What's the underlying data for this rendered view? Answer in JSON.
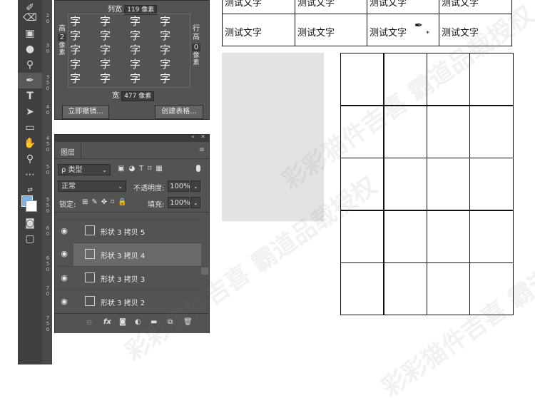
{
  "toolbar": {
    "tools": [
      "brush-icon",
      "eraser-icon",
      "gradient-icon",
      "blur-icon",
      "dodge-icon",
      "pen-icon",
      "type-icon",
      "path-select-icon",
      "rectangle-icon",
      "hand-icon",
      "zoom-icon",
      "more-icon",
      "swap-colors-icon",
      "foreground-color-icon",
      "quick-mask-icon",
      "screen-mode-icon"
    ],
    "foreground_color": "#7ab3e6"
  },
  "ruler": {
    "labels": [
      "2",
      "0",
      "3",
      "0",
      "3",
      "5",
      "0",
      "4",
      "0",
      "4",
      "5",
      "0",
      "5",
      "0",
      "5",
      "5",
      "0",
      "6",
      "0",
      "6",
      "5",
      "0",
      "7",
      "0",
      "7",
      "5",
      "0"
    ]
  },
  "table_panel": {
    "col_width_label": "列宽",
    "col_width_value": "119 像素",
    "row_height_label": "高",
    "row_height_value": "2",
    "row_height_unit": "像素",
    "rows_label": "行",
    "rows_label2": "高",
    "rows_value": "0",
    "rows_unit": "像素",
    "width_label": "宽",
    "width_value": "477 像素",
    "grid_char": "字",
    "undo_button": "立即撤销...",
    "create_button": "创建表格..."
  },
  "layers_panel": {
    "tab_label": "图层",
    "filter_label": "ρ 类型",
    "blend_mode": "正常",
    "opacity_label": "不透明度:",
    "opacity_value": "100%",
    "lock_label": "锁定:",
    "fill_label": "填充:",
    "fill_value": "100%",
    "layers": [
      {
        "name": "形状 3 拷贝 5"
      },
      {
        "name": "形状 3 拷贝 4"
      },
      {
        "name": "形状 3 拷贝 3"
      },
      {
        "name": "形状 3 拷贝 2"
      }
    ]
  },
  "canvas": {
    "cell_text": "测试文字",
    "watermark_text": "彩彩猫件吉喜 霸道品载授权"
  }
}
